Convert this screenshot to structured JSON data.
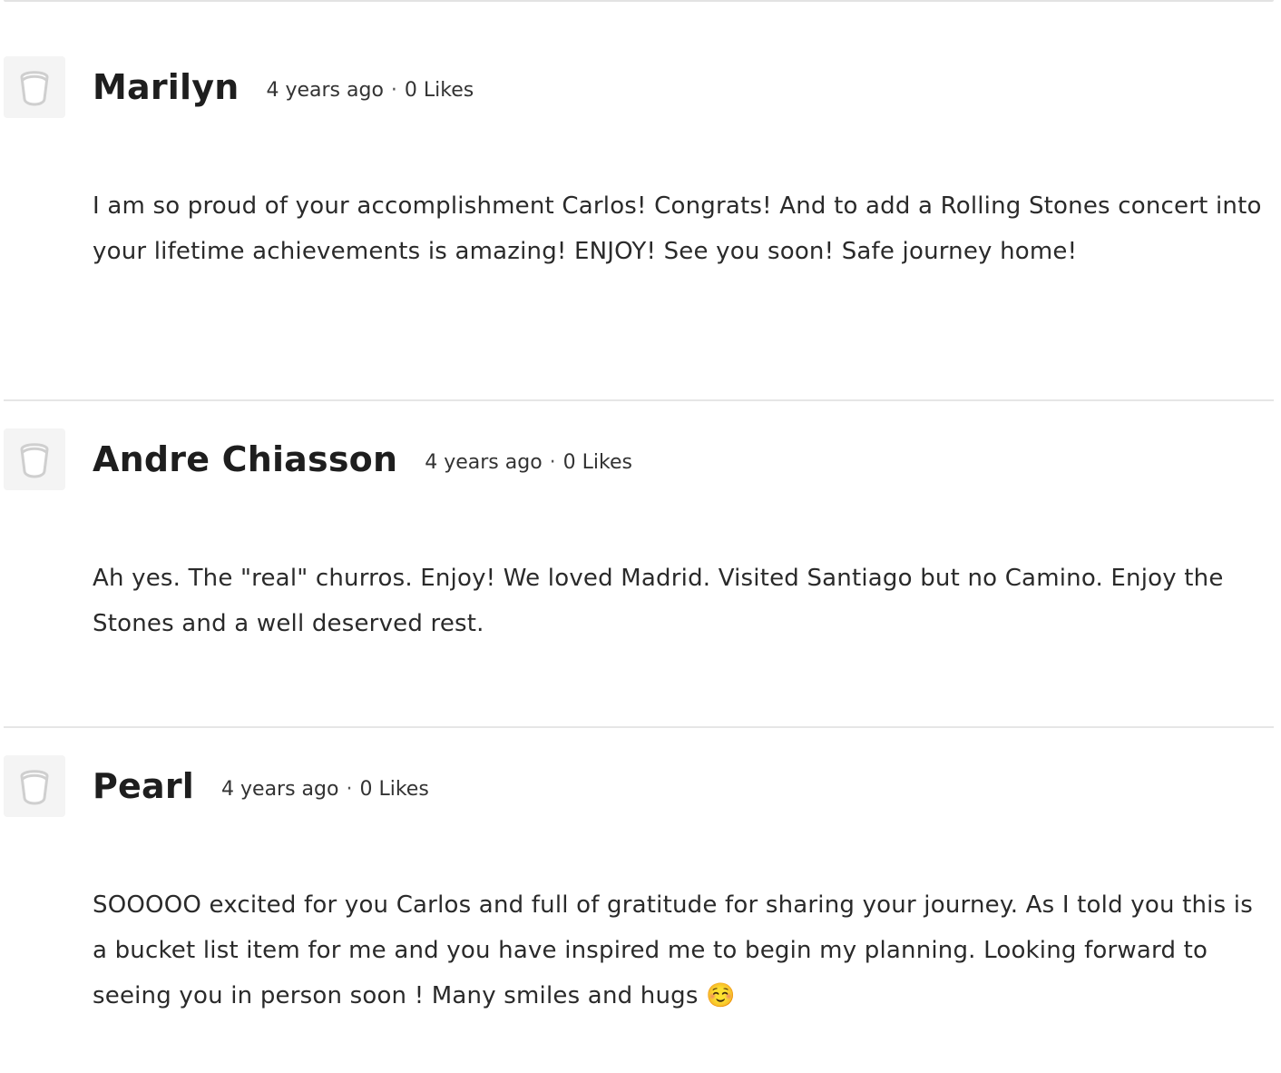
{
  "comments": [
    {
      "author": "Marilyn",
      "time": "4 years ago",
      "separator": "·",
      "likes": "0 Likes",
      "text": "I am so proud of your accomplishment Carlos! Congrats! And to add a Rolling Stones concert into your lifetime achievements is amazing! ENJOY! See you soon! Safe journey home!",
      "avatar_icon": "default-avatar-icon"
    },
    {
      "author": "Andre Chiasson",
      "time": "4 years ago",
      "separator": "·",
      "likes": "0 Likes",
      "text": "Ah yes. The \"real\" churros. Enjoy! We loved Madrid. Visited Santiago but no Camino. Enjoy the Stones and a well deserved rest.",
      "avatar_icon": "default-avatar-icon"
    },
    {
      "author": "Pearl",
      "time": "4 years ago",
      "separator": "·",
      "likes": "0 Likes",
      "text": "SOOOOO excited for you Carlos and full of gratitude for sharing your journey. As I told you this is a bucket list item for me and you have inspired me to begin my planning. Looking forward to seeing you in person soon ! Many smiles and hugs ☺️",
      "avatar_icon": "default-avatar-icon"
    }
  ],
  "colors": {
    "text": "#222222",
    "divider": "#e6e6e6",
    "avatar_bg": "#f4f4f4",
    "avatar_icon": "#cfcfcf"
  }
}
